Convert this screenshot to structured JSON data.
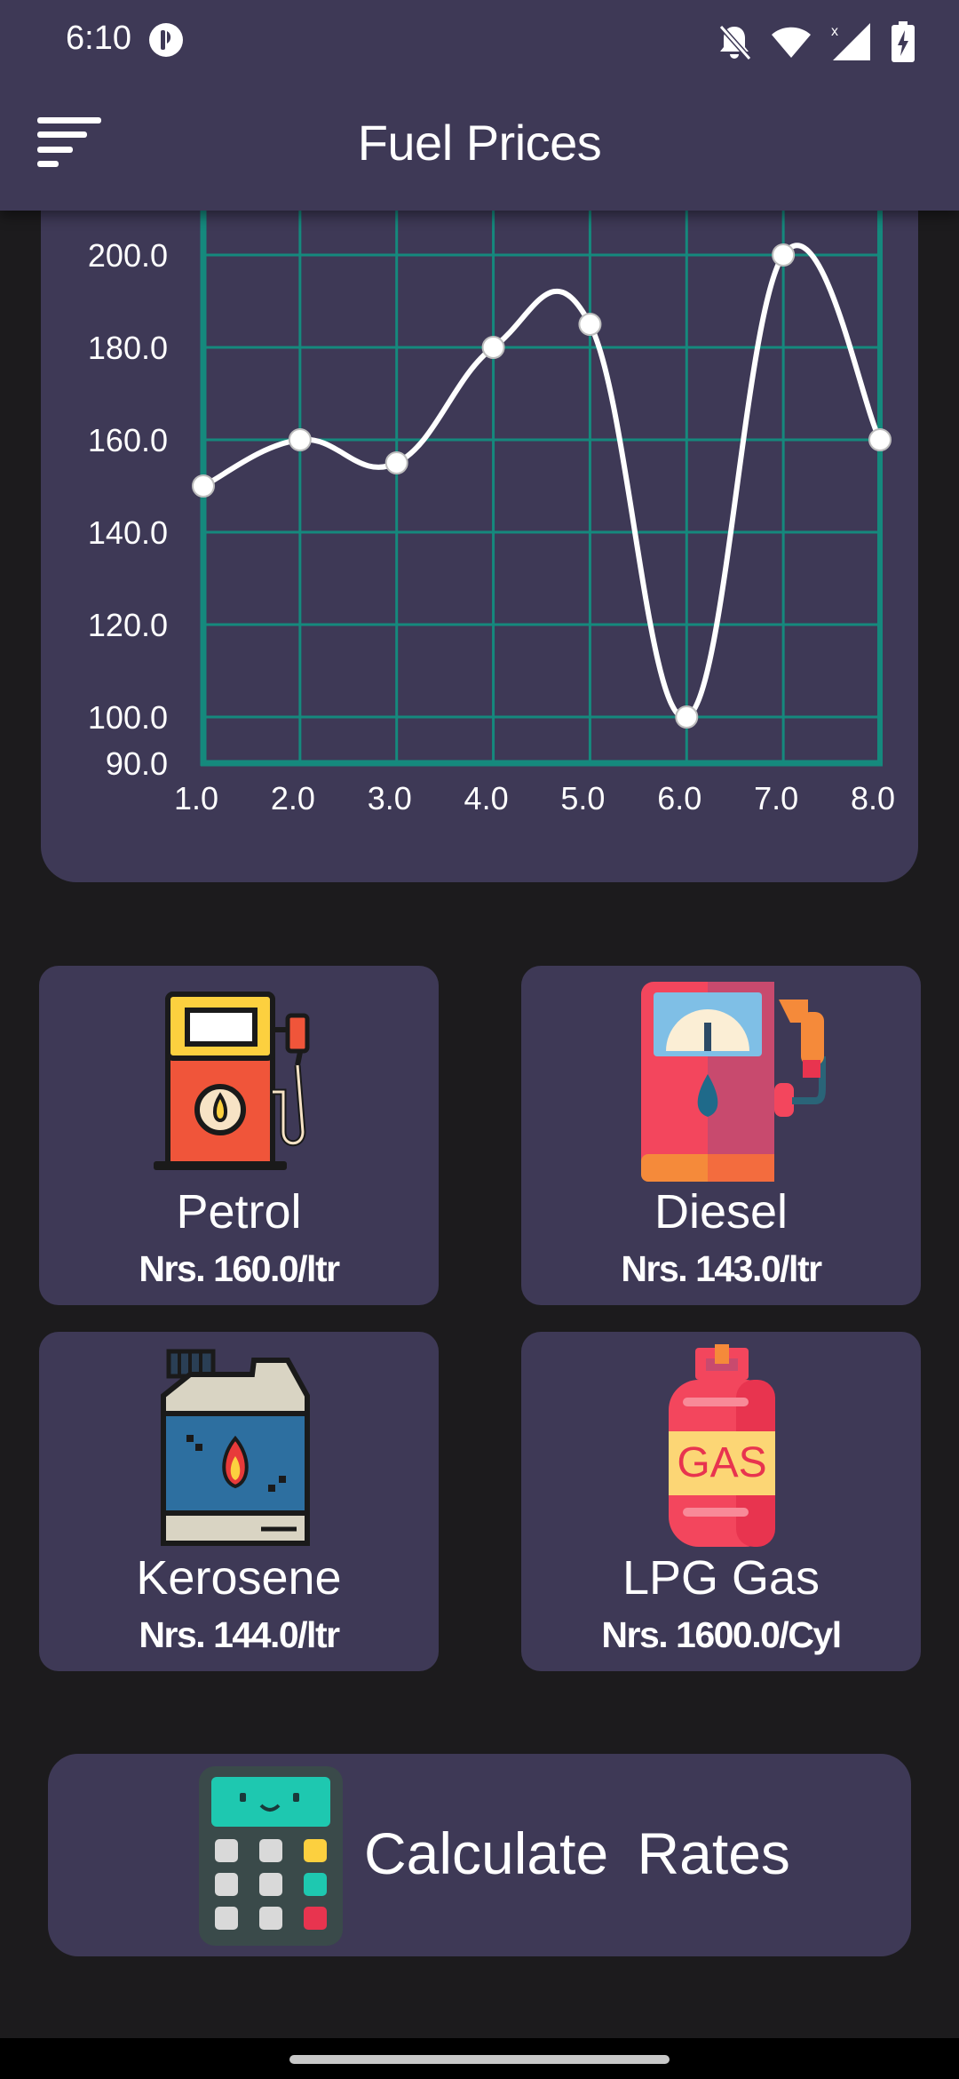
{
  "status_bar": {
    "time": "6:10",
    "icons": [
      "profile-badge-icon",
      "bell-off-icon",
      "wifi-icon",
      "signal-icon",
      "battery-charging-icon"
    ]
  },
  "app_bar": {
    "title": "Fuel Prices",
    "menu_icon": "menu-icon"
  },
  "chart_data": {
    "type": "line",
    "x": [
      1.0,
      2.0,
      3.0,
      4.0,
      5.0,
      6.0,
      7.0,
      8.0
    ],
    "values": [
      150,
      160,
      155,
      180,
      185,
      100,
      200,
      160
    ],
    "x_tick_labels": [
      "1.0",
      "2.0",
      "3.0",
      "4.0",
      "5.0",
      "6.0",
      "7.0",
      "8.0"
    ],
    "y_tick_labels": [
      "200.0",
      "180.0",
      "160.0",
      "140.0",
      "120.0",
      "100.0",
      "90.0"
    ],
    "y_ticks": [
      200,
      180,
      160,
      140,
      120,
      100,
      90
    ],
    "xlim": [
      1.0,
      8.0
    ],
    "ylim": [
      90,
      200
    ],
    "grid": true,
    "smooth": true,
    "colors": {
      "line": "#ffffff",
      "grid": "#15897d",
      "axis": "#15897d",
      "point_fill": "#ffffff"
    }
  },
  "fuels": [
    {
      "name": "Petrol",
      "price": "Nrs. 160.0/ltr",
      "icon": "petrol-pump-icon"
    },
    {
      "name": "Diesel",
      "price": "Nrs. 143.0/ltr",
      "icon": "diesel-pump-icon"
    },
    {
      "name": "Kerosene",
      "price": "Nrs. 144.0/ltr",
      "icon": "kerosene-jerrycan-icon"
    },
    {
      "name": "LPG Gas",
      "price": "Nrs. 1600.0/Cyl",
      "icon": "gas-cylinder-icon",
      "icon_text": "GAS"
    }
  ],
  "calculate": {
    "label": "Calculate  Rates",
    "icon": "calculator-icon"
  },
  "theme": {
    "background": "#1c1b1d",
    "card": "#3e3956",
    "accent": "#15897d"
  }
}
